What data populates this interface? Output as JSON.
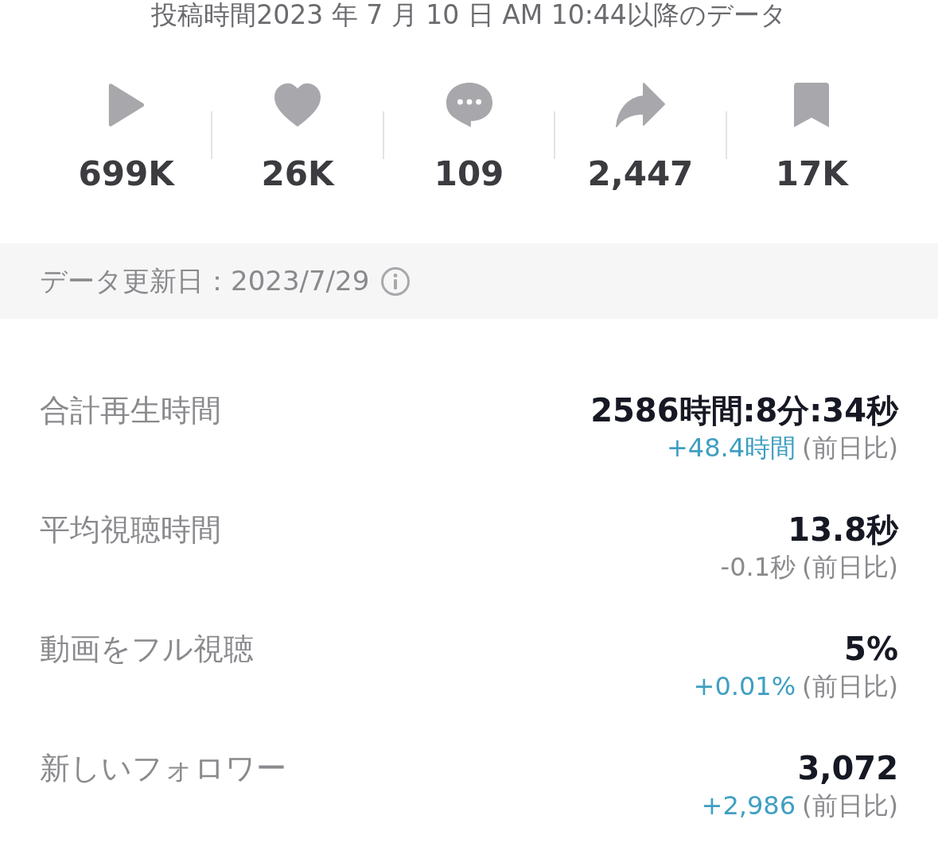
{
  "header": {
    "text": "投稿時間2023 年 7 月 10 日 AM 10:44以降のデータ"
  },
  "stats": [
    {
      "kind": "play",
      "value": "699K"
    },
    {
      "kind": "like",
      "value": "26K"
    },
    {
      "kind": "comment",
      "value": "109"
    },
    {
      "kind": "share",
      "value": "2,447"
    },
    {
      "kind": "save",
      "value": "17K"
    }
  ],
  "update_bar": {
    "text": "データ更新日：2023/7/29"
  },
  "metrics": [
    {
      "label": "合計再生時間",
      "value": "2586時間:8分:34秒",
      "delta": {
        "text": "+48.4時間",
        "color": "#3f9fc2"
      },
      "note": "(前日比)"
    },
    {
      "label": "平均視聴時間",
      "value": "13.8秒",
      "delta": {
        "text": "-0.1秒",
        "color": "#8a8a8e"
      },
      "note": "(前日比)"
    },
    {
      "label": "動画をフル視聴",
      "value": "5%",
      "delta": {
        "text": "+0.01%",
        "color": "#3f9fc2"
      },
      "note": "(前日比)"
    },
    {
      "label": "新しいフォロワー",
      "value": "3,072",
      "delta": {
        "text": "+2,986",
        "color": "#3f9fc2"
      },
      "note": "(前日比)"
    }
  ]
}
